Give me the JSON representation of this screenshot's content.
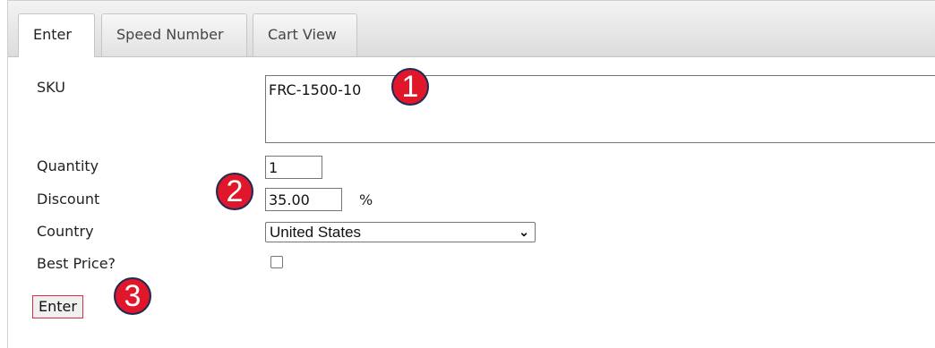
{
  "tabs": [
    {
      "label": "Enter",
      "active": true
    },
    {
      "label": "Speed Number",
      "active": false
    },
    {
      "label": "Cart View",
      "active": false
    }
  ],
  "form": {
    "sku_label": "SKU",
    "sku_value": "FRC-1500-10",
    "quantity_label": "Quantity",
    "quantity_value": "1",
    "discount_label": "Discount",
    "discount_value": "35.00",
    "discount_unit": "%",
    "country_label": "Country",
    "country_value": "United States",
    "best_price_label": "Best Price?",
    "best_price_checked": false,
    "enter_button": "Enter"
  },
  "callouts": [
    "1",
    "2",
    "3"
  ],
  "colors": {
    "callout_fill": "#e0162b",
    "callout_border": "#1b2a56",
    "button_border": "#d9304a"
  },
  "icons": {
    "select_arrow": "chevron-down-icon"
  }
}
